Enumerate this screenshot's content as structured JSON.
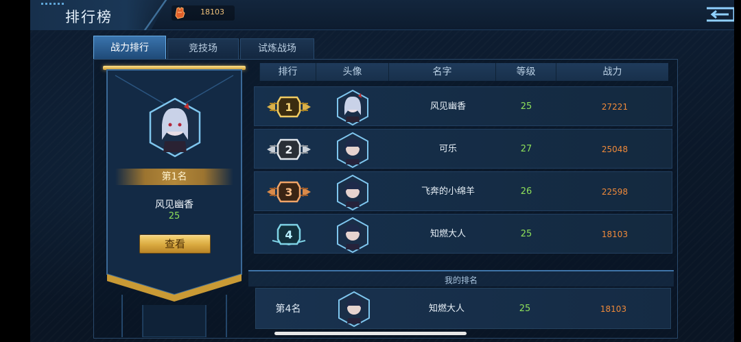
{
  "header": {
    "title": "排行榜",
    "power_value": "18103"
  },
  "tabs": [
    {
      "label": "战力排行",
      "active": true
    },
    {
      "label": "竞技场",
      "active": false
    },
    {
      "label": "试炼战场",
      "active": false
    }
  ],
  "top_player": {
    "rank_label": "第1名",
    "name": "风见幽香",
    "level": "25",
    "view_button": "查看"
  },
  "table": {
    "headers": [
      "排行",
      "头像",
      "名字",
      "等级",
      "战力"
    ],
    "rows": [
      {
        "rank": "1",
        "name": "风见幽香",
        "level": "25",
        "power": "27221",
        "badge_color": "#d9b14a",
        "avatar": "white-hair-girl"
      },
      {
        "rank": "2",
        "name": "可乐",
        "level": "27",
        "power": "25048",
        "badge_color": "#c7ced6",
        "avatar": "dark-hair-girl"
      },
      {
        "rank": "3",
        "name": "飞奔的小绵羊",
        "level": "26",
        "power": "22598",
        "badge_color": "#d98a4a",
        "avatar": "dark-hair-girl"
      },
      {
        "rank": "4",
        "name": "知燃大人",
        "level": "25",
        "power": "18103",
        "badge_color": "#7fd3e6",
        "avatar": "dark-hair-girl"
      }
    ]
  },
  "my_rank": {
    "section_title": "我的排名",
    "rank": "第4名",
    "name": "知燃大人",
    "level": "25",
    "power": "18103"
  },
  "colors": {
    "level_green": "#8ee05a",
    "power_orange": "#f08a3a",
    "gold": "#d9a93f",
    "accent_blue": "#3a74ad"
  }
}
